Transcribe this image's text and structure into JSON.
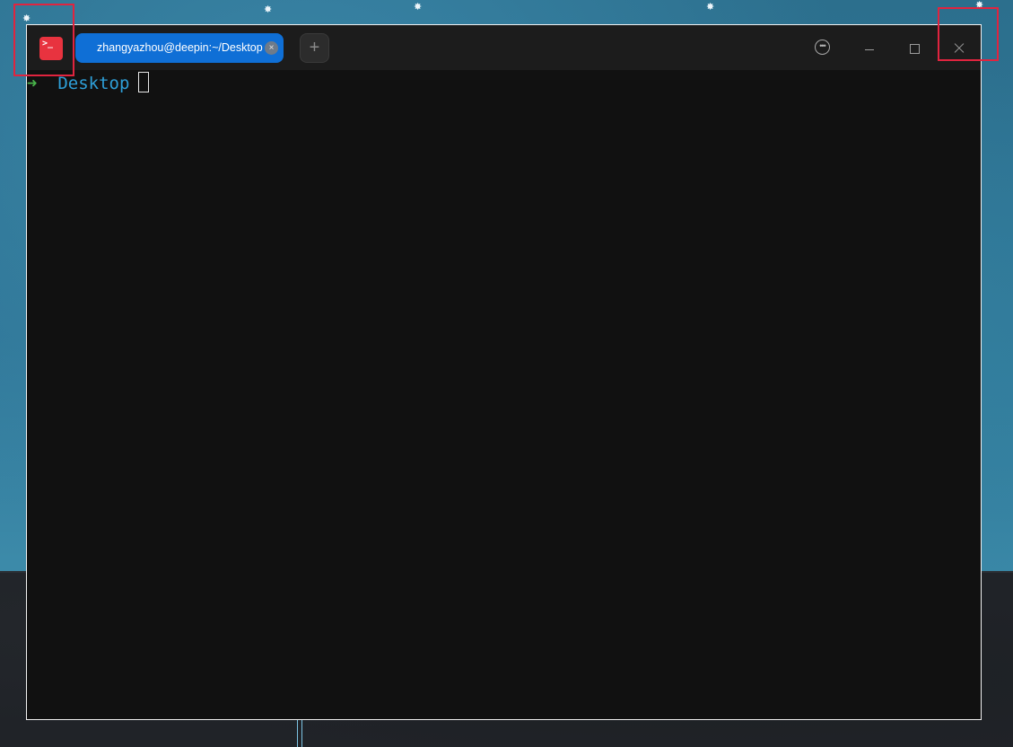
{
  "window": {
    "app_icon_glyph": ">_",
    "tab_title": "zhangyazhou@deepin:~/Desktop",
    "tab_close_glyph": "×",
    "new_tab_glyph": "+",
    "menu_glyph": "•••"
  },
  "terminal": {
    "prompt_arrow": "➜",
    "prompt_dir": "Desktop"
  },
  "icons": {
    "app": "terminal-icon",
    "tab_close": "close-icon",
    "new_tab": "plus-icon",
    "menu": "more-icon",
    "minimize": "minimize-icon",
    "maximize": "maximize-icon",
    "close": "close-icon"
  },
  "colors": {
    "tab_active": "#0f6fd6",
    "app_icon": "#e8333f",
    "prompt_arrow": "#49b54b",
    "prompt_dir": "#2e9fd8",
    "highlight": "#e0243f"
  }
}
